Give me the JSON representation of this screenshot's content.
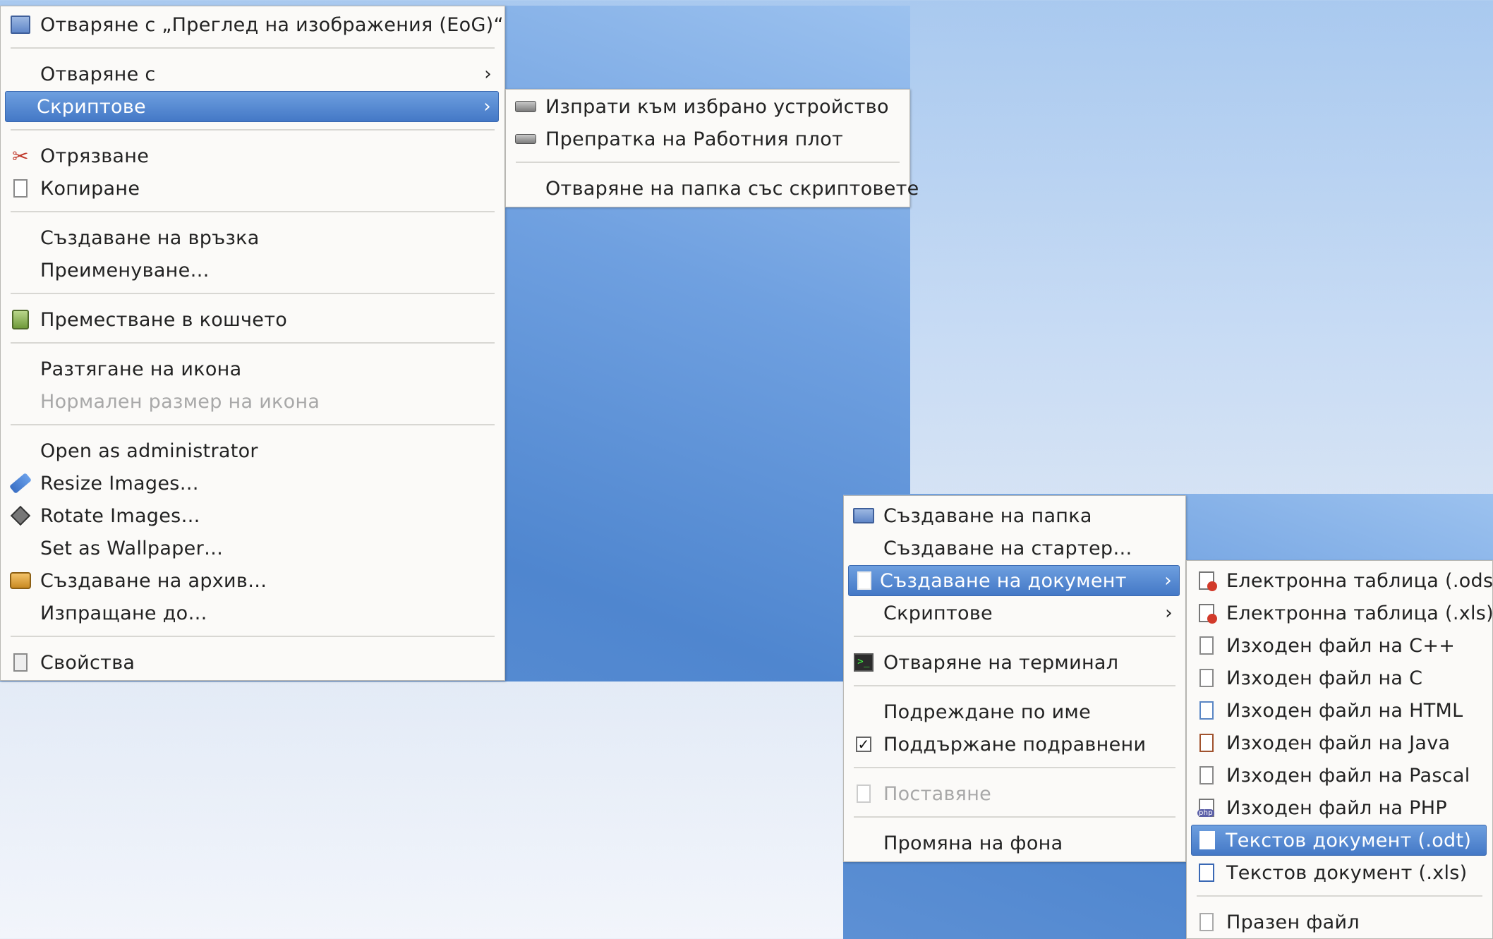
{
  "main_menu": {
    "items": [
      {
        "label": "Отваряне с „Преглед на изображения (EoG)“",
        "icon": "image-viewer-icon"
      },
      {
        "label": "Отваряне с"
      },
      {
        "label": "Скриптове"
      },
      {
        "label": "Отрязване",
        "icon": "scissors-icon"
      },
      {
        "label": "Копиране",
        "icon": "copy-icon"
      },
      {
        "label": "Създаване на връзка"
      },
      {
        "label": "Преименуване…"
      },
      {
        "label": "Преместване в кошчето",
        "icon": "trash-icon"
      },
      {
        "label": "Разтягане на икона"
      },
      {
        "label": "Нормален размер на икона"
      },
      {
        "label": "Open as administrator"
      },
      {
        "label": "Resize Images…",
        "icon": "resize-icon"
      },
      {
        "label": "Rotate Images…",
        "icon": "rotate-icon"
      },
      {
        "label": "Set as Wallpaper…"
      },
      {
        "label": "Създаване на архив…",
        "icon": "archive-icon"
      },
      {
        "label": "Изпращане до…"
      },
      {
        "label": "Свойства",
        "icon": "properties-icon"
      }
    ]
  },
  "scripts_submenu": {
    "items": [
      {
        "label": "Изпрати към избрано устройство",
        "icon": "drive-icon"
      },
      {
        "label": "Препратка на Работния плот",
        "icon": "drive-icon"
      },
      {
        "label": "Отваряне на папка със скриптовете"
      }
    ]
  },
  "desktop_menu": {
    "items": [
      {
        "label": "Създаване на папка",
        "icon": "folder-icon"
      },
      {
        "label": "Създаване на стартер…"
      },
      {
        "label": "Създаване на документ",
        "icon": "new-document-icon"
      },
      {
        "label": "Скриптове"
      },
      {
        "label": "Отваряне на терминал",
        "icon": "terminal-icon"
      },
      {
        "label": "Подреждане по име"
      },
      {
        "label": "Поддържане подравнени",
        "checked": true
      },
      {
        "label": "Поставяне",
        "icon": "paste-icon"
      },
      {
        "label": "Промяна на фона"
      }
    ]
  },
  "document_submenu": {
    "items": [
      {
        "label": "Електронна таблица (.ods)",
        "icon": "spreadsheet-icon"
      },
      {
        "label": "Електронна таблица (.xls)",
        "icon": "spreadsheet-icon"
      },
      {
        "label": "Изходен файл на C++",
        "icon": "source-file-icon"
      },
      {
        "label": "Изходен файл на C",
        "icon": "source-file-icon"
      },
      {
        "label": "Изходен файл на HTML",
        "icon": "html-file-icon"
      },
      {
        "label": "Изходен файл на Java",
        "icon": "java-file-icon"
      },
      {
        "label": "Изходен файл на Pascal",
        "icon": "text-file-icon"
      },
      {
        "label": "Изходен файл на PHP",
        "icon": "php-file-icon"
      },
      {
        "label": "Текстов документ (.odt)",
        "icon": "text-document-icon"
      },
      {
        "label": "Текстов документ (.xls)",
        "icon": "text-document-icon"
      },
      {
        "label": "Празен файл",
        "icon": "empty-file-icon"
      }
    ]
  },
  "colors": {
    "selection": "#4478c6",
    "menu_bg": "#fbfaf8",
    "desktop": "#5b8fd4"
  }
}
